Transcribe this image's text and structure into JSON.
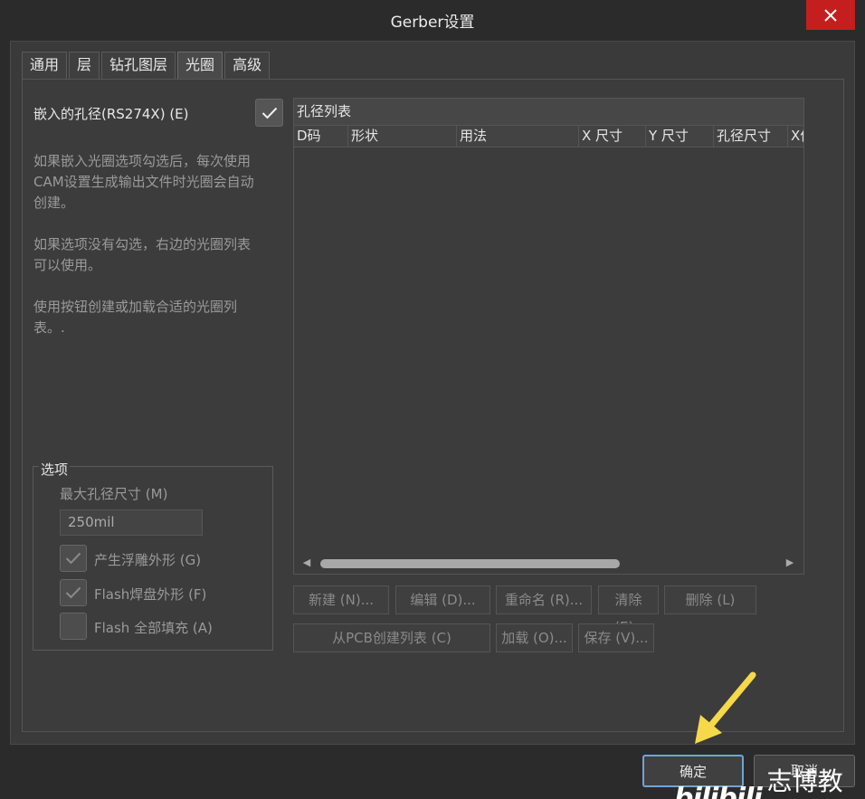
{
  "window": {
    "title": "Gerber设置"
  },
  "tabs": [
    {
      "label": "通用"
    },
    {
      "label": "层"
    },
    {
      "label": "钻孔图层"
    },
    {
      "label": "光圈"
    },
    {
      "label": "高级"
    }
  ],
  "left": {
    "embed_label": "嵌入的孔径(RS274X) (E)",
    "embed_checked": true,
    "desc1": "如果嵌入光圈选项勾选后，每次使用CAM设置生成输出文件时光圈会自动创建。",
    "desc2": "如果选项没有勾选，右边的光圈列表可以使用。",
    "desc3": "使用按钮创建或加载合适的光圈列表。."
  },
  "options": {
    "title": "选项",
    "max_label": "最大孔径尺寸 (M)",
    "max_value": "250mil",
    "chk1_label": "产生浮雕外形 (G)",
    "chk2_label": "Flash焊盘外形 (F)",
    "chk3_label": "Flash 全部填充 (A)"
  },
  "list": {
    "title": "孔径列表",
    "columns": [
      "D码",
      "形状",
      "用法",
      "X 尺寸",
      "Y 尺寸",
      "孔径尺寸",
      "X偏"
    ]
  },
  "buttons": {
    "new": "新建 (N)...",
    "edit": "编辑 (D)...",
    "rename": "重命名 (R)...",
    "clear": "清除 (E)..",
    "delete": "删除 (L)",
    "from_pcb": "从PCB创建列表 (C)",
    "load": "加载 (O)...",
    "save": "保存 (V)..."
  },
  "dialog": {
    "ok": "确定",
    "cancel": "取消"
  },
  "watermark": {
    "logo": "bilibili",
    "text": "志博教育"
  },
  "colors": {
    "close_bg": "#c41e1e",
    "arrow": "#f5d94a",
    "primary_border": "#6fa4d8"
  }
}
